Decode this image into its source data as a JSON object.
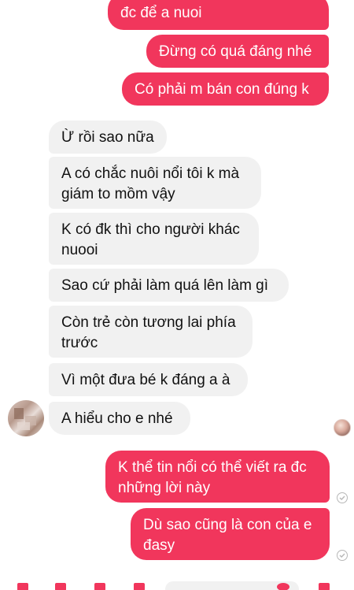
{
  "colors": {
    "sent_bubble": "#f1365c",
    "received_bubble": "#f1f1f1",
    "sent_text": "#ffffff",
    "received_text": "#111111"
  },
  "messages_top_sent": [
    {
      "text": "đc để a nuoi"
    },
    {
      "text": "Đừng có quá đáng nhé"
    },
    {
      "text": "Có phải m bán con đúng k"
    }
  ],
  "messages_received": [
    {
      "line1": "Ừ rồi sao nữa",
      "line2": ""
    },
    {
      "line1": "A có chắc nuôi nổi tôi k mà",
      "line2": "giám to mồm vậy"
    },
    {
      "line1": "K có đk thì cho người khác",
      "line2": "nuooi"
    },
    {
      "line1": "Sao cứ phải làm quá lên làm gì",
      "line2": ""
    },
    {
      "line1": "Còn trẻ còn tương lai phía",
      "line2": "trước"
    },
    {
      "line1": "Vì một đưa bé k đáng a à",
      "line2": ""
    },
    {
      "line1": "A hiểu cho e nhé",
      "line2": ""
    }
  ],
  "messages_bottom_sent": [
    {
      "line1": "K thể tin nổi có thể viết ra đc",
      "line2": "những lời này"
    },
    {
      "line1": "Dù sao cũng là con của e",
      "line2": "đasy"
    }
  ],
  "icons": {
    "received_avatar": "avatar-icon",
    "seen_avatar": "seen-avatar-icon",
    "delivered": "check-circle-icon"
  }
}
